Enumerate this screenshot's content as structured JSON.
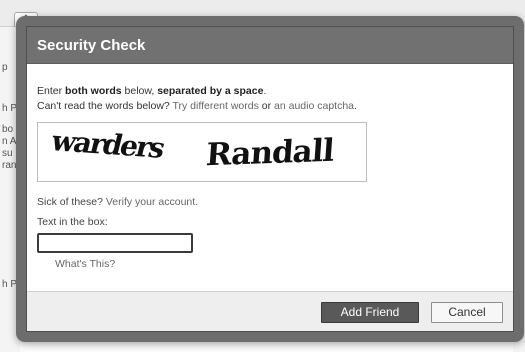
{
  "background": {
    "stepper_glyph": "⇕",
    "fragments": [
      "p",
      "h P",
      "bo",
      "n A",
      "su",
      "ran",
      "h P"
    ]
  },
  "dialog": {
    "title": "Security Check",
    "instructions": {
      "prefix": "Enter ",
      "bold1": "both words",
      "middle": " below, ",
      "bold2": "separated by a space",
      "suffix": ".",
      "line2_prefix": "Can't read the words below? ",
      "try_link": "Try different words",
      "or_text": " or ",
      "audio_link": "an audio captcha",
      "line2_suffix": "."
    },
    "captcha": {
      "word1": "warders",
      "word2": "Randall"
    },
    "verify": {
      "prefix": "Sick of these? ",
      "link": "Verify your account."
    },
    "field_label": "Text in the box:",
    "input_value": "",
    "whats_this": "What's This?",
    "buttons": {
      "submit": "Add Friend",
      "cancel": "Cancel"
    }
  },
  "colors": {
    "modal_header": "#717171",
    "primary_button": "#595959",
    "footer_bg": "#eeeeee"
  }
}
